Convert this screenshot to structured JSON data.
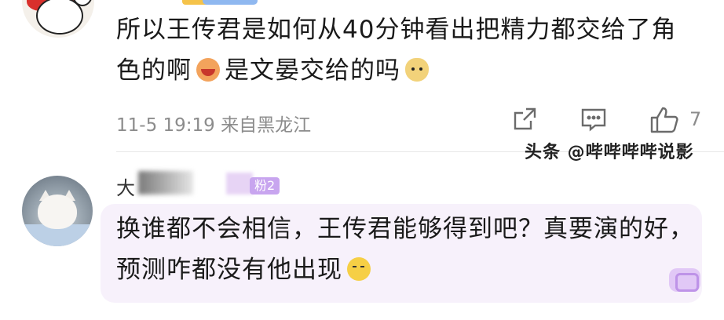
{
  "comments": [
    {
      "text_part1": "所以王传君是如何从40分钟看出把精力都交给了角色的啊",
      "emoji1": "laughing-face-emoji",
      "text_part2": "是文晏交给的吗",
      "emoji2": "doge-emoji",
      "time": "11-5 19:19",
      "location": "来自黑龙江",
      "like_count": "7"
    },
    {
      "username_visible_char": "大",
      "fan_badge": "粉2",
      "text": "换谁都不会相信，王传君能够得到吧？真要演的好，预测咋都没有他出现",
      "emoji": "thinking-face-emoji"
    }
  ],
  "watermark": "头条 @哔哔哔哔说影",
  "icons": {
    "share": "share-icon",
    "reply": "comment-icon",
    "like": "thumbs-up-icon"
  }
}
